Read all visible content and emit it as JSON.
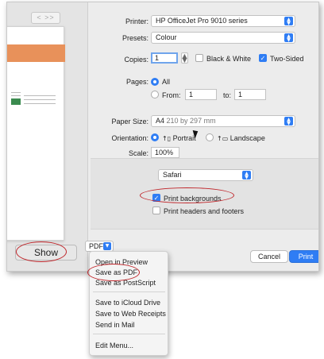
{
  "preview": {
    "pager_label": "< >>",
    "show_button": "Show"
  },
  "printer": {
    "label": "Printer:",
    "value": "HP OfficeJet Pro 9010 series"
  },
  "presets": {
    "label": "Presets:",
    "value": "Colour"
  },
  "copies": {
    "label": "Copies:",
    "value": "1",
    "bw_label": "Black & White",
    "bw_checked": false,
    "two_sided_label": "Two-Sided",
    "two_sided_checked": true
  },
  "pages": {
    "label": "Pages:",
    "all_label": "All",
    "from_label": "From:",
    "from_value": "1",
    "to_label": "to:",
    "to_value": "1"
  },
  "paper_size": {
    "label": "Paper Size:",
    "value": "A4",
    "dims": "210 by 297 mm"
  },
  "orientation": {
    "label": "Orientation:",
    "portrait_label": "Portrait",
    "landscape_label": "Landscape"
  },
  "scale": {
    "label": "Scale:",
    "value": "100%"
  },
  "app_section": {
    "popup_value": "Safari",
    "print_backgrounds_label": "Print backgrounds",
    "print_backgrounds_checked": true,
    "headers_footers_label": "Print headers and footers",
    "headers_footers_checked": false
  },
  "bottom_bar": {
    "pdf_label": "PDF",
    "cancel_label": "Cancel",
    "print_label": "Print"
  },
  "pdf_menu": {
    "items": [
      "Open in Preview",
      "Save as PDF",
      "Save as PostScript",
      "Save to iCloud Drive",
      "Save to Web Receipts",
      "Send in Mail",
      "Edit Menu..."
    ]
  },
  "colors": {
    "accent": "#2f7df4",
    "annotation": "#c0262b"
  }
}
